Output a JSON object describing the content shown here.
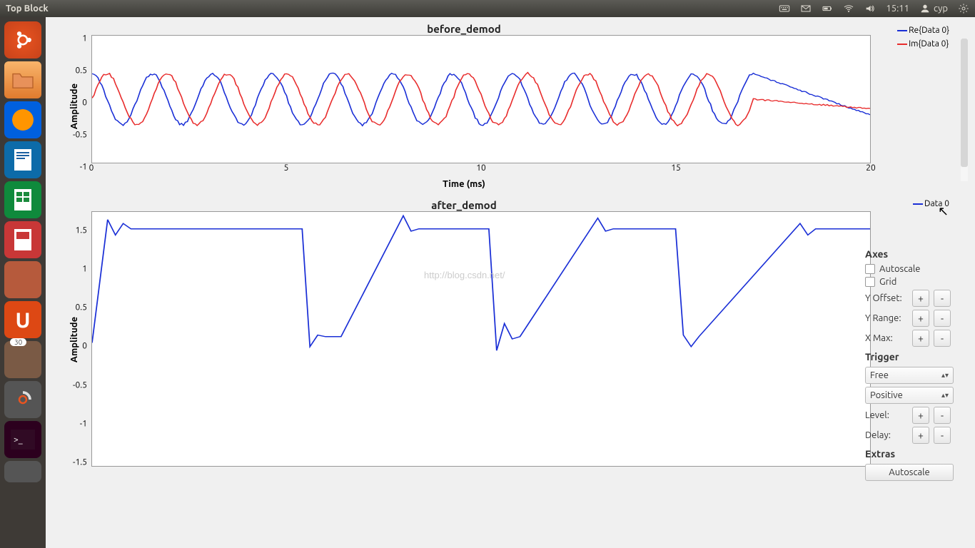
{
  "topbar": {
    "title": "Top Block",
    "time": "15:11",
    "user": "cyp"
  },
  "chart_data": [
    {
      "type": "line",
      "title": "before_demod",
      "xlabel": "Time (ms)",
      "ylabel": "Amplitude",
      "xlim": [
        0,
        20
      ],
      "ylim": [
        -1,
        1
      ],
      "x_ticks": [
        0,
        5,
        10,
        15,
        20
      ],
      "y_ticks": [
        -1,
        -0.5,
        0,
        0.5,
        1
      ],
      "series": [
        {
          "name": "Re{Data 0}",
          "color": "#1a2fd6",
          "amplitude": 0.4,
          "cycles": 11,
          "phase_deg": 90,
          "tail_value": -0.25
        },
        {
          "name": "Im{Data 0}",
          "color": "#e82c2c",
          "amplitude": 0.4,
          "cycles": 11,
          "phase_deg": 0,
          "tail_value": -0.15
        }
      ]
    },
    {
      "type": "line",
      "title": "after_demod",
      "xlabel": "",
      "ylabel": "Amplitude",
      "xlim": [
        0,
        20
      ],
      "ylim": [
        -1.6,
        1.7
      ],
      "x_ticks": [],
      "y_ticks": [
        -1.5,
        -1,
        -0.5,
        0,
        0.5,
        1,
        1.5
      ],
      "series": [
        {
          "name": "Data 0",
          "color": "#1a2fd6",
          "x": [
            0,
            0.4,
            0.6,
            0.8,
            1.0,
            5.4,
            5.6,
            5.8,
            6.0,
            6.4,
            8.0,
            8.2,
            8.4,
            10.2,
            10.4,
            10.6,
            10.8,
            11.0,
            13.0,
            13.2,
            13.4,
            15.0,
            15.2,
            15.4,
            15.6,
            18.2,
            18.4,
            18.6,
            20.0
          ],
          "values": [
            0.0,
            1.6,
            1.4,
            1.55,
            1.48,
            1.48,
            -0.05,
            0.1,
            0.08,
            0.08,
            1.65,
            1.45,
            1.48,
            1.48,
            -0.1,
            0.25,
            0.05,
            0.08,
            1.62,
            1.45,
            1.48,
            1.48,
            0.1,
            -0.05,
            0.08,
            1.55,
            1.4,
            1.48,
            1.48
          ]
        }
      ]
    }
  ],
  "panel": {
    "axes": {
      "heading": "Axes",
      "autoscale": "Autoscale",
      "grid": "Grid",
      "yoffset": "Y Offset:",
      "yrange": "Y Range:",
      "xmax": "X Max:"
    },
    "trigger": {
      "heading": "Trigger",
      "mode": "Free",
      "slope": "Positive",
      "level": "Level:",
      "delay": "Delay:"
    },
    "extras": {
      "heading": "Extras",
      "autoscale_btn": "Autoscale"
    },
    "plus": "+",
    "minus": "-"
  },
  "watermark": "http://blog.csdn.net/"
}
